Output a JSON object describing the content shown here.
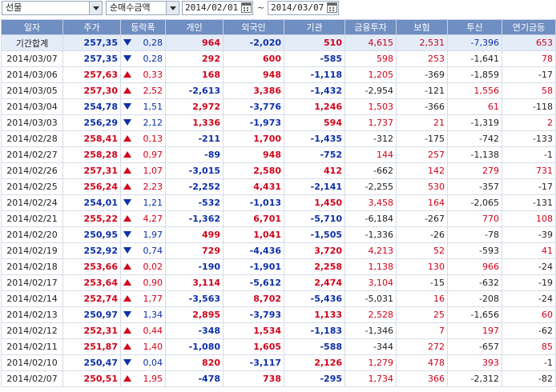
{
  "toolbar": {
    "market": "선물",
    "metric": "순매수금액",
    "date_from": "2014/02/01",
    "date_sep": "~",
    "date_to": "2014/03/07"
  },
  "columns": [
    "일자",
    "주가",
    "등락폭",
    "개인",
    "외국인",
    "기관",
    "금융투자",
    "보험",
    "투신",
    "연기금등"
  ],
  "rows": [
    {
      "date": "기간합계",
      "price": "257,35",
      "pc": "blue",
      "dir": "down",
      "chg": "0,28",
      "ind": "964",
      "ic": "red",
      "frg": "-2,020",
      "fc": "blue",
      "inst": "510",
      "nc": "red",
      "fin": "4,615",
      "fic": "red",
      "ins": "2,531",
      "isc": "red",
      "trs": "-7,396",
      "tc": "blue",
      "pen": "653",
      "pnc": "red"
    },
    {
      "date": "2014/03/07",
      "price": "257,35",
      "pc": "blue",
      "dir": "down",
      "chg": "0,28",
      "ind": "292",
      "ic": "red",
      "frg": "600",
      "fc": "red",
      "inst": "-585",
      "nc": "blue",
      "fin": "598",
      "fic": "red",
      "ins": "253",
      "isc": "red",
      "trs": "-1,641",
      "tc": "blk",
      "pen": "78",
      "pnc": "red"
    },
    {
      "date": "2014/03/06",
      "price": "257,63",
      "pc": "red",
      "dir": "up",
      "chg": "0,33",
      "ind": "168",
      "ic": "red",
      "frg": "948",
      "fc": "red",
      "inst": "-1,118",
      "nc": "blue",
      "fin": "1,205",
      "fic": "red",
      "ins": "-369",
      "isc": "blk",
      "trs": "-1,859",
      "tc": "blk",
      "pen": "-17",
      "pnc": "blk"
    },
    {
      "date": "2014/03/05",
      "price": "257,30",
      "pc": "red",
      "dir": "up",
      "chg": "2,52",
      "ind": "-2,613",
      "ic": "blue",
      "frg": "3,386",
      "fc": "red",
      "inst": "-1,432",
      "nc": "blue",
      "fin": "-2,954",
      "fic": "blk",
      "ins": "-121",
      "isc": "blk",
      "trs": "1,556",
      "tc": "red",
      "pen": "58",
      "pnc": "red"
    },
    {
      "date": "2014/03/04",
      "price": "254,78",
      "pc": "blue",
      "dir": "down",
      "chg": "1,51",
      "ind": "2,972",
      "ic": "red",
      "frg": "-3,776",
      "fc": "blue",
      "inst": "1,246",
      "nc": "red",
      "fin": "1,503",
      "fic": "red",
      "ins": "-366",
      "isc": "blk",
      "trs": "61",
      "tc": "red",
      "pen": "-118",
      "pnc": "blk"
    },
    {
      "date": "2014/03/03",
      "price": "256,29",
      "pc": "blue",
      "dir": "down",
      "chg": "2,12",
      "ind": "1,336",
      "ic": "red",
      "frg": "-1,973",
      "fc": "blue",
      "inst": "594",
      "nc": "red",
      "fin": "1,737",
      "fic": "red",
      "ins": "21",
      "isc": "red",
      "trs": "-1,319",
      "tc": "blk",
      "pen": "2",
      "pnc": "red"
    },
    {
      "date": "2014/02/28",
      "price": "258,41",
      "pc": "red",
      "dir": "up",
      "chg": "0,13",
      "ind": "-211",
      "ic": "blue",
      "frg": "1,700",
      "fc": "red",
      "inst": "-1,435",
      "nc": "blue",
      "fin": "-312",
      "fic": "blk",
      "ins": "-175",
      "isc": "blk",
      "trs": "-742",
      "tc": "blk",
      "pen": "-133",
      "pnc": "blk"
    },
    {
      "date": "2014/02/27",
      "price": "258,28",
      "pc": "red",
      "dir": "up",
      "chg": "0,97",
      "ind": "-89",
      "ic": "blue",
      "frg": "948",
      "fc": "red",
      "inst": "-752",
      "nc": "blue",
      "fin": "144",
      "fic": "red",
      "ins": "257",
      "isc": "red",
      "trs": "-1,138",
      "tc": "blk",
      "pen": "-1",
      "pnc": "blk"
    },
    {
      "date": "2014/02/26",
      "price": "257,31",
      "pc": "red",
      "dir": "up",
      "chg": "1,07",
      "ind": "-3,015",
      "ic": "blue",
      "frg": "2,580",
      "fc": "red",
      "inst": "412",
      "nc": "red",
      "fin": "-662",
      "fic": "blk",
      "ins": "142",
      "isc": "red",
      "trs": "279",
      "tc": "red",
      "pen": "731",
      "pnc": "red"
    },
    {
      "date": "2014/02/25",
      "price": "256,24",
      "pc": "red",
      "dir": "up",
      "chg": "2,23",
      "ind": "-2,252",
      "ic": "blue",
      "frg": "4,431",
      "fc": "red",
      "inst": "-2,141",
      "nc": "blue",
      "fin": "-2,255",
      "fic": "blk",
      "ins": "530",
      "isc": "red",
      "trs": "-357",
      "tc": "blk",
      "pen": "-17",
      "pnc": "blk"
    },
    {
      "date": "2014/02/24",
      "price": "254,01",
      "pc": "blue",
      "dir": "down",
      "chg": "1,21",
      "ind": "-532",
      "ic": "blue",
      "frg": "-1,013",
      "fc": "blue",
      "inst": "1,450",
      "nc": "red",
      "fin": "3,458",
      "fic": "red",
      "ins": "164",
      "isc": "red",
      "trs": "-2,065",
      "tc": "blk",
      "pen": "-131",
      "pnc": "blk"
    },
    {
      "date": "2014/02/21",
      "price": "255,22",
      "pc": "red",
      "dir": "up",
      "chg": "4,27",
      "ind": "-1,362",
      "ic": "blue",
      "frg": "6,701",
      "fc": "red",
      "inst": "-5,710",
      "nc": "blue",
      "fin": "-6,184",
      "fic": "blk",
      "ins": "-267",
      "isc": "blk",
      "trs": "770",
      "tc": "red",
      "pen": "108",
      "pnc": "red"
    },
    {
      "date": "2014/02/20",
      "price": "250,95",
      "pc": "blue",
      "dir": "down",
      "chg": "1,97",
      "ind": "499",
      "ic": "red",
      "frg": "1,041",
      "fc": "red",
      "inst": "-1,505",
      "nc": "blue",
      "fin": "-1,336",
      "fic": "blk",
      "ins": "-26",
      "isc": "blk",
      "trs": "-78",
      "tc": "blk",
      "pen": "-39",
      "pnc": "blk"
    },
    {
      "date": "2014/02/19",
      "price": "252,92",
      "pc": "blue",
      "dir": "down",
      "chg": "0,74",
      "ind": "729",
      "ic": "red",
      "frg": "-4,436",
      "fc": "blue",
      "inst": "3,720",
      "nc": "red",
      "fin": "4,213",
      "fic": "red",
      "ins": "52",
      "isc": "red",
      "trs": "-593",
      "tc": "blk",
      "pen": "41",
      "pnc": "red"
    },
    {
      "date": "2014/02/18",
      "price": "253,66",
      "pc": "red",
      "dir": "up",
      "chg": "0,02",
      "ind": "-190",
      "ic": "blue",
      "frg": "-1,901",
      "fc": "blue",
      "inst": "2,258",
      "nc": "red",
      "fin": "1,138",
      "fic": "red",
      "ins": "130",
      "isc": "red",
      "trs": "966",
      "tc": "red",
      "pen": "-24",
      "pnc": "blk"
    },
    {
      "date": "2014/02/17",
      "price": "253,64",
      "pc": "red",
      "dir": "up",
      "chg": "0,90",
      "ind": "3,114",
      "ic": "red",
      "frg": "-5,612",
      "fc": "blue",
      "inst": "2,474",
      "nc": "red",
      "fin": "3,104",
      "fic": "red",
      "ins": "-15",
      "isc": "blk",
      "trs": "-632",
      "tc": "blk",
      "pen": "-19",
      "pnc": "blk"
    },
    {
      "date": "2014/02/14",
      "price": "252,74",
      "pc": "red",
      "dir": "up",
      "chg": "1,77",
      "ind": "-3,563",
      "ic": "blue",
      "frg": "8,702",
      "fc": "red",
      "inst": "-5,436",
      "nc": "blue",
      "fin": "-5,031",
      "fic": "blk",
      "ins": "16",
      "isc": "red",
      "trs": "-208",
      "tc": "blk",
      "pen": "-24",
      "pnc": "blk"
    },
    {
      "date": "2014/02/13",
      "price": "250,97",
      "pc": "blue",
      "dir": "down",
      "chg": "1,34",
      "ind": "2,895",
      "ic": "red",
      "frg": "-3,793",
      "fc": "blue",
      "inst": "1,133",
      "nc": "red",
      "fin": "2,528",
      "fic": "red",
      "ins": "25",
      "isc": "red",
      "trs": "-1,656",
      "tc": "blk",
      "pen": "60",
      "pnc": "red"
    },
    {
      "date": "2014/02/12",
      "price": "252,31",
      "pc": "red",
      "dir": "up",
      "chg": "0,44",
      "ind": "-348",
      "ic": "blue",
      "frg": "1,534",
      "fc": "red",
      "inst": "-1,183",
      "nc": "blue",
      "fin": "-1,346",
      "fic": "blk",
      "ins": "7",
      "isc": "red",
      "trs": "197",
      "tc": "red",
      "pen": "-62",
      "pnc": "blk"
    },
    {
      "date": "2014/02/11",
      "price": "251,87",
      "pc": "red",
      "dir": "up",
      "chg": "1,40",
      "ind": "-1,080",
      "ic": "blue",
      "frg": "1,605",
      "fc": "red",
      "inst": "-588",
      "nc": "blue",
      "fin": "-344",
      "fic": "blk",
      "ins": "272",
      "isc": "red",
      "trs": "-657",
      "tc": "blk",
      "pen": "85",
      "pnc": "red"
    },
    {
      "date": "2014/02/10",
      "price": "250,47",
      "pc": "blue",
      "dir": "down",
      "chg": "0,04",
      "ind": "820",
      "ic": "red",
      "frg": "-3,117",
      "fc": "blue",
      "inst": "2,126",
      "nc": "red",
      "fin": "1,279",
      "fic": "red",
      "ins": "478",
      "isc": "red",
      "trs": "393",
      "tc": "red",
      "pen": "-1",
      "pnc": "blk"
    },
    {
      "date": "2014/02/07",
      "price": "250,51",
      "pc": "red",
      "dir": "up",
      "chg": "1,95",
      "ind": "-478",
      "ic": "blue",
      "frg": "738",
      "fc": "red",
      "inst": "-295",
      "nc": "blue",
      "fin": "1,734",
      "fic": "red",
      "ins": "366",
      "isc": "red",
      "trs": "-2,312",
      "tc": "blk",
      "pen": "-82",
      "pnc": "blk"
    }
  ],
  "colors": {
    "header_bg": "#6f8ec1",
    "total_bg": "#e4ecf8",
    "up": "#d0021b",
    "down": "#0b2fa8"
  }
}
